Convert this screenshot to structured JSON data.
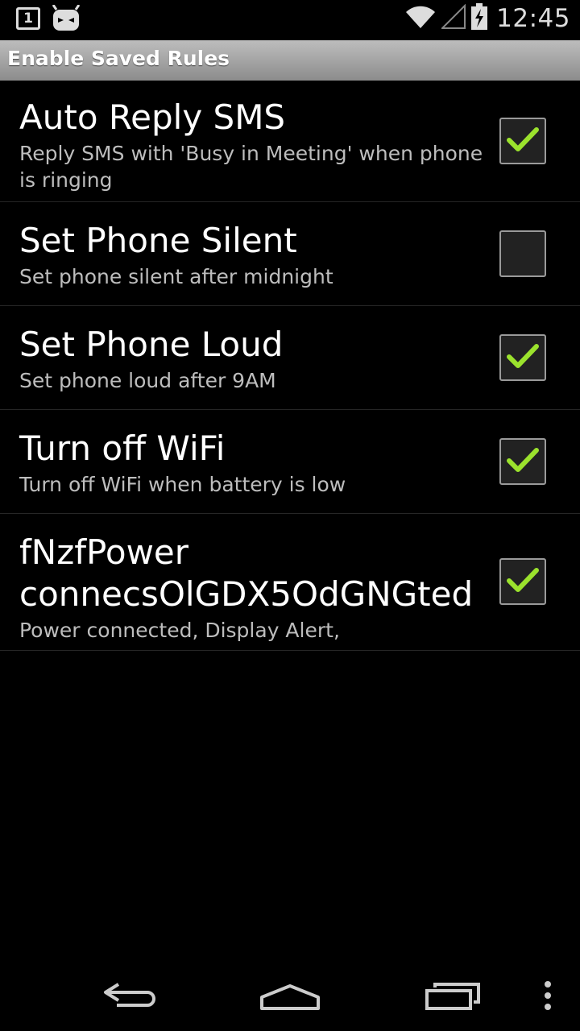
{
  "status_bar": {
    "notification_icons": [
      "calendar-notification-icon",
      "cyanogenmod-mascot-icon"
    ],
    "calendar_day": "1",
    "status_icons": [
      "wifi-icon",
      "cell-signal-icon",
      "battery-charging-icon"
    ],
    "clock": "12:45"
  },
  "header": {
    "title": "Enable Saved Rules"
  },
  "rules": [
    {
      "title": "Auto Reply SMS",
      "summary": "Reply SMS with 'Busy in Meeting' when phone is ringing",
      "checked": true
    },
    {
      "title": "Set Phone Silent",
      "summary": "Set phone silent after midnight",
      "checked": false
    },
    {
      "title": "Set Phone Loud",
      "summary": "Set phone loud after 9AM",
      "checked": true
    },
    {
      "title": "Turn off WiFi",
      "summary": "Turn off WiFi when battery is low",
      "checked": true
    },
    {
      "title": "fNzfPower connecsOlGDX5OdGNGted",
      "summary": "Power connected, Display Alert,",
      "checked": true
    }
  ],
  "nav_bar": {
    "buttons": [
      "back-icon",
      "home-icon",
      "recents-icon",
      "overflow-menu-icon"
    ]
  },
  "colors": {
    "background": "#000000",
    "header_gradient_top": "#bdbdbd",
    "header_gradient_bottom": "#8c8c8c",
    "checkmark": "#9be22d",
    "summary_text": "#bdbdbd",
    "divider": "#262626"
  }
}
